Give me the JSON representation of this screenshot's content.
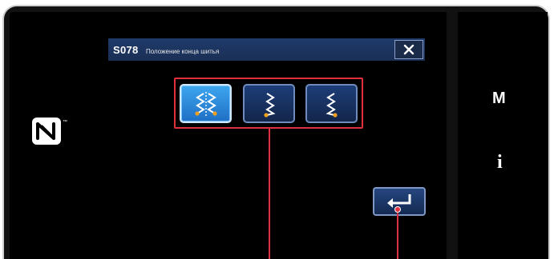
{
  "dialog": {
    "code": "S078",
    "title": "Положение конца шитья"
  },
  "options": [
    {
      "icon": "zigzag-both-ends-icon",
      "selected": true
    },
    {
      "icon": "zigzag-end-left-icon",
      "selected": false
    },
    {
      "icon": "zigzag-end-right-icon",
      "selected": false
    }
  ],
  "side_panel": {
    "mode_label": "M",
    "info_label": "i"
  },
  "icons": {
    "close": "close-icon",
    "enter": "enter-icon",
    "nfc": "nfc-icon"
  },
  "colors": {
    "selected": "#2f8fe0",
    "button": "#1a3566",
    "callout": "#e0303c",
    "stitch_dot": "#f0a020"
  }
}
